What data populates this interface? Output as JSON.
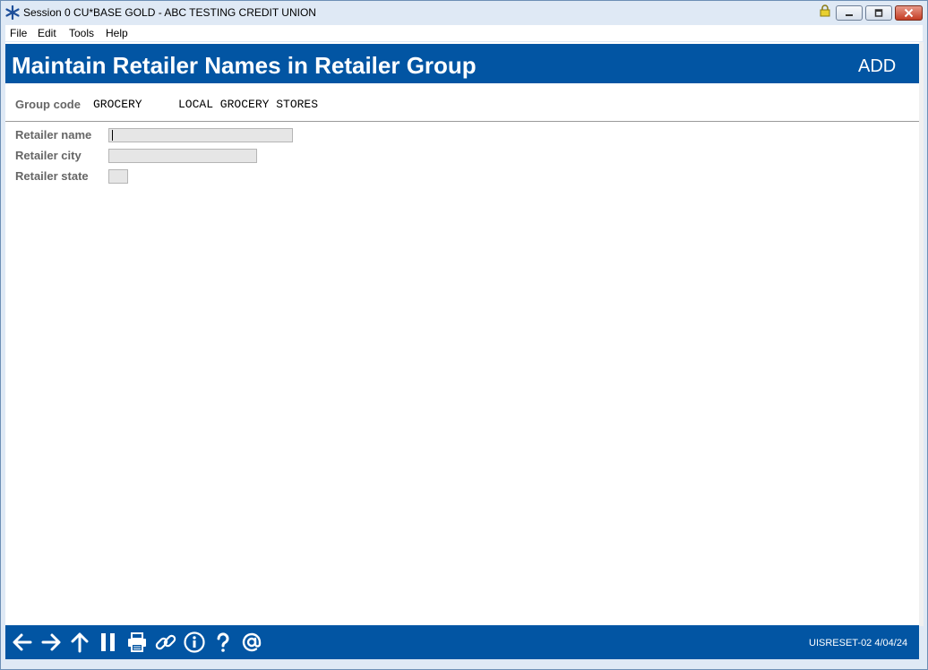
{
  "window": {
    "title": "Session 0 CU*BASE GOLD - ABC TESTING CREDIT UNION"
  },
  "menu": {
    "items": [
      "File",
      "Edit",
      "Tools",
      "Help"
    ]
  },
  "header": {
    "title": "Maintain Retailer Names in Retailer Group",
    "mode": "ADD"
  },
  "group": {
    "label": "Group code",
    "code": "GROCERY",
    "description": "LOCAL GROCERY STORES"
  },
  "form": {
    "retailer_name_label": "Retailer name",
    "retailer_name_value": "",
    "retailer_city_label": "Retailer city",
    "retailer_city_value": "",
    "retailer_state_label": "Retailer state",
    "retailer_state_value": ""
  },
  "footer": {
    "icons": [
      "back-arrow-icon",
      "forward-arrow-icon",
      "up-arrow-icon",
      "pause-icon",
      "print-icon",
      "link-icon",
      "info-icon",
      "help-icon",
      "at-icon"
    ],
    "status": "UISRESET-02 4/04/24"
  },
  "colors": {
    "accent": "#0255a3",
    "label": "#666666",
    "field_bg": "#e6e6e6"
  }
}
